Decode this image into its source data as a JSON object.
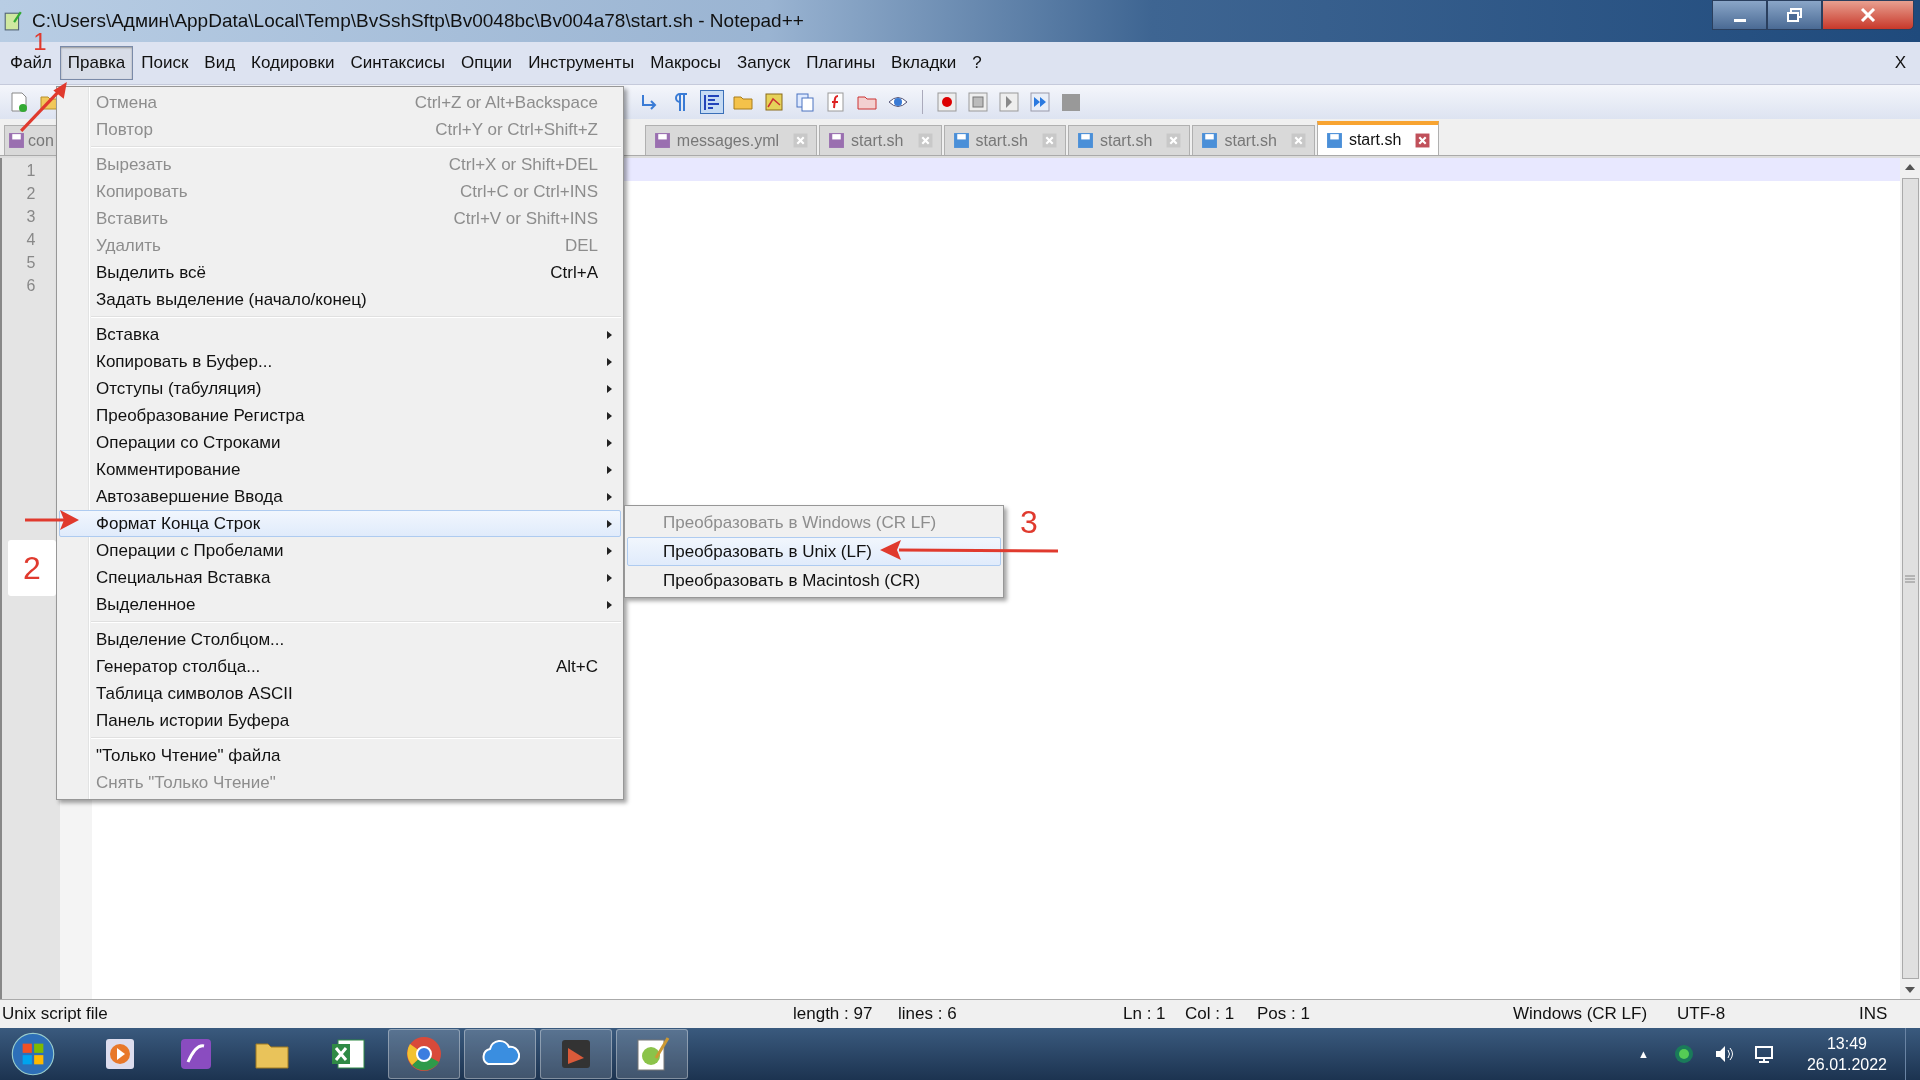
{
  "window": {
    "title": "C:\\Users\\Админ\\AppData\\Local\\Temp\\BvSshSftp\\Bv0048bc\\Bv004a78\\start.sh - Notepad++",
    "close_doc": "X"
  },
  "menubar": [
    {
      "label": "Файл",
      "selected": false
    },
    {
      "label": "Правка",
      "selected": true
    },
    {
      "label": "Поиск",
      "selected": false
    },
    {
      "label": "Вид",
      "selected": false
    },
    {
      "label": "Кодировки",
      "selected": false
    },
    {
      "label": "Синтаксисы",
      "selected": false
    },
    {
      "label": "Опции",
      "selected": false
    },
    {
      "label": "Инструменты",
      "selected": false
    },
    {
      "label": "Макросы",
      "selected": false
    },
    {
      "label": "Запуск",
      "selected": false
    },
    {
      "label": "Плагины",
      "selected": false
    },
    {
      "label": "Вкладки",
      "selected": false
    },
    {
      "label": "?",
      "selected": false
    }
  ],
  "tabs": [
    {
      "label": "con",
      "selected": false,
      "color": "#9a6fb0"
    },
    {
      "label": "messages.yml",
      "selected": false,
      "color": "#9a6fb0"
    },
    {
      "label": "start.sh",
      "selected": false,
      "color": "#9a6fb0"
    },
    {
      "label": "start.sh",
      "selected": false,
      "color": "#4a8fd8"
    },
    {
      "label": "start.sh",
      "selected": false,
      "color": "#4a8fd8"
    },
    {
      "label": "start.sh",
      "selected": false,
      "color": "#4a8fd8"
    },
    {
      "label": "start.sh",
      "selected": true,
      "color": "#4a8fd8"
    }
  ],
  "line_numbers": [
    "1",
    "2",
    "3",
    "4",
    "5",
    "6"
  ],
  "edit_menu": [
    [
      {
        "label": "Отмена",
        "shortcut": "Ctrl+Z or Alt+Backspace",
        "disabled": true,
        "submenu": false,
        "selected": false
      },
      {
        "label": "Повтор",
        "shortcut": "Ctrl+Y or Ctrl+Shift+Z",
        "disabled": true,
        "submenu": false,
        "selected": false
      }
    ],
    [
      {
        "label": "Вырезать",
        "shortcut": "Ctrl+X or Shift+DEL",
        "disabled": true,
        "submenu": false,
        "selected": false
      },
      {
        "label": "Копировать",
        "shortcut": "Ctrl+C or Ctrl+INS",
        "disabled": true,
        "submenu": false,
        "selected": false
      },
      {
        "label": "Вставить",
        "shortcut": "Ctrl+V or Shift+INS",
        "disabled": true,
        "submenu": false,
        "selected": false
      },
      {
        "label": "Удалить",
        "shortcut": "DEL",
        "disabled": true,
        "submenu": false,
        "selected": false
      },
      {
        "label": "Выделить всё",
        "shortcut": "Ctrl+A",
        "disabled": false,
        "submenu": false,
        "selected": false
      },
      {
        "label": "Задать выделение (начало/конец)",
        "disabled": false,
        "submenu": false,
        "selected": false
      }
    ],
    [
      {
        "label": "Вставка",
        "disabled": false,
        "submenu": true,
        "selected": false
      },
      {
        "label": "Копировать в Буфер...",
        "disabled": false,
        "submenu": true,
        "selected": false
      },
      {
        "label": "Отступы (табуляция)",
        "disabled": false,
        "submenu": true,
        "selected": false
      },
      {
        "label": "Преобразование Регистра",
        "disabled": false,
        "submenu": true,
        "selected": false
      },
      {
        "label": "Операции со Строками",
        "disabled": false,
        "submenu": true,
        "selected": false
      },
      {
        "label": "Комментирование",
        "disabled": false,
        "submenu": true,
        "selected": false
      },
      {
        "label": "Автозавершение Ввода",
        "disabled": false,
        "submenu": true,
        "selected": false
      },
      {
        "label": "Формат Конца Строк",
        "disabled": false,
        "submenu": true,
        "selected": true
      },
      {
        "label": "Операции с Пробелами",
        "disabled": false,
        "submenu": true,
        "selected": false
      },
      {
        "label": "Специальная Вставка",
        "disabled": false,
        "submenu": true,
        "selected": false
      },
      {
        "label": "Выделенное",
        "disabled": false,
        "submenu": true,
        "selected": false
      }
    ],
    [
      {
        "label": "Выделение Столбцом...",
        "disabled": false,
        "submenu": false,
        "selected": false
      },
      {
        "label": "Генератор столбца...",
        "shortcut": "Alt+C",
        "disabled": false,
        "submenu": false,
        "selected": false
      },
      {
        "label": "Таблица символов ASCII",
        "disabled": false,
        "submenu": false,
        "selected": false
      },
      {
        "label": "Панель истории Буфера",
        "disabled": false,
        "submenu": false,
        "selected": false
      }
    ],
    [
      {
        "label": "\"Только Чтение\" файла",
        "disabled": false,
        "submenu": false,
        "selected": false
      },
      {
        "label": "Снять \"Только Чтение\"",
        "disabled": true,
        "submenu": false,
        "selected": false
      }
    ]
  ],
  "eol_submenu": [
    {
      "label": "Преобразовать в Windows (CR LF)",
      "disabled": true,
      "selected": false
    },
    {
      "label": "Преобразовать в Unix (LF)",
      "disabled": false,
      "selected": true
    },
    {
      "label": "Преобразовать в Macintosh (CR)",
      "disabled": false,
      "selected": false
    }
  ],
  "annotations": [
    "1",
    "2",
    "3"
  ],
  "status_bar": {
    "file_type": "Unix script file",
    "length": "length : 97",
    "lines": "lines : 6",
    "ln": "Ln : 1",
    "col": "Col : 1",
    "pos": "Pos : 1",
    "eol": "Windows (CR LF)",
    "encoding": "UTF-8",
    "mode": "INS"
  },
  "taskbar": {
    "apps": [
      {
        "kind": "media",
        "selected": false
      },
      {
        "kind": "viewer",
        "selected": false
      },
      {
        "kind": "folder",
        "selected": false
      },
      {
        "kind": "excel",
        "selected": false
      },
      {
        "kind": "chrome",
        "selected": true
      },
      {
        "kind": "cloud",
        "selected": true
      },
      {
        "kind": "slides",
        "selected": true
      },
      {
        "kind": "notepad",
        "selected": true
      }
    ],
    "tray_caret": "▲",
    "time": "13:49",
    "date": "26.01.2022"
  }
}
